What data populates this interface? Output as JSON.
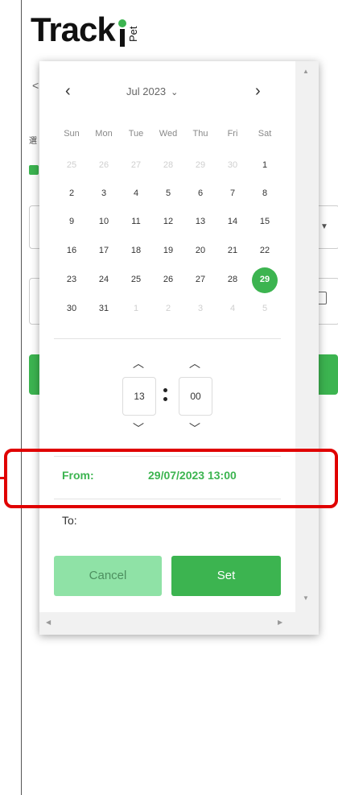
{
  "app": {
    "logo_text": "Track",
    "logo_sub": "Pet"
  },
  "background": {
    "nav_left": "<",
    "label_fragment": "選"
  },
  "picker": {
    "month_label": "Jul 2023",
    "nav_prev": "‹",
    "nav_next": "›",
    "weekdays": [
      "Sun",
      "Mon",
      "Tue",
      "Wed",
      "Thu",
      "Fri",
      "Sat"
    ],
    "weeks": [
      [
        "25",
        "26",
        "27",
        "28",
        "29",
        "30",
        "1"
      ],
      [
        "2",
        "3",
        "4",
        "5",
        "6",
        "7",
        "8"
      ],
      [
        "9",
        "10",
        "11",
        "12",
        "13",
        "14",
        "15"
      ],
      [
        "16",
        "17",
        "18",
        "19",
        "20",
        "21",
        "22"
      ],
      [
        "23",
        "24",
        "25",
        "26",
        "27",
        "28",
        "29"
      ],
      [
        "30",
        "31",
        "1",
        "2",
        "3",
        "4",
        "5"
      ]
    ],
    "selected_day": "29",
    "time": {
      "hour": "13",
      "minute": "00"
    },
    "from_label": "From:",
    "from_value": "29/07/2023 13:00",
    "to_label": "To:",
    "cancel_label": "Cancel",
    "set_label": "Set"
  },
  "colors": {
    "accent": "#3cb450",
    "accent_light": "#8fe2a6",
    "highlight": "#e00000"
  }
}
